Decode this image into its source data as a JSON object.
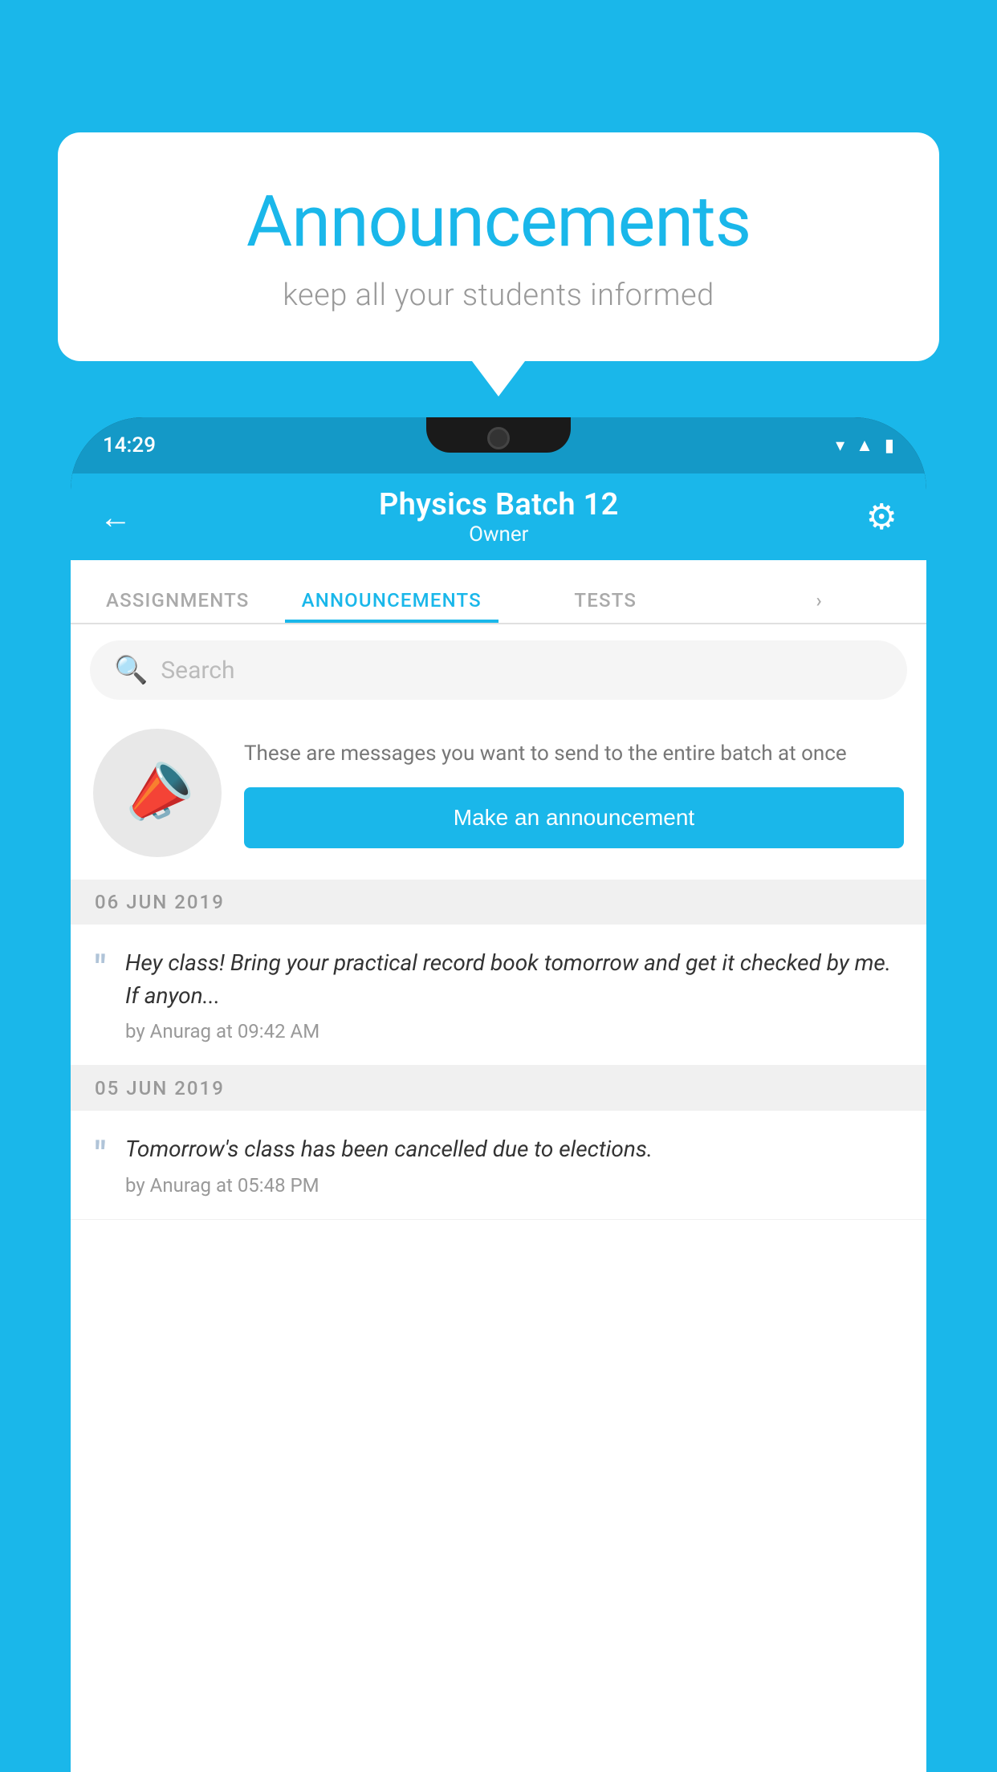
{
  "page": {
    "background_color": "#1ab7ea"
  },
  "speech_bubble": {
    "title": "Announcements",
    "subtitle": "keep all your students informed",
    "title_color": "#1ab7ea",
    "subtitle_color": "#999999",
    "background": "white"
  },
  "status_bar": {
    "time": "14:29",
    "icons": [
      "wifi",
      "signal",
      "battery"
    ]
  },
  "app_bar": {
    "back_label": "←",
    "title": "Physics Batch 12",
    "subtitle": "Owner",
    "gear_label": "⚙"
  },
  "tabs": [
    {
      "label": "ASSIGNMENTS",
      "active": false
    },
    {
      "label": "ANNOUNCEMENTS",
      "active": true
    },
    {
      "label": "TESTS",
      "active": false
    },
    {
      "label": "",
      "active": false
    }
  ],
  "search": {
    "placeholder": "Search"
  },
  "promo": {
    "description": "These are messages you want to send to the entire batch at once",
    "button_label": "Make an announcement"
  },
  "announcements": [
    {
      "date": "06  JUN  2019",
      "text": "Hey class! Bring your practical record book tomorrow and get it checked by me. If anyon...",
      "meta": "by Anurag at 09:42 AM"
    },
    {
      "date": "05  JUN  2019",
      "text": "Tomorrow's class has been cancelled due to elections.",
      "meta": "by Anurag at 05:48 PM"
    }
  ]
}
